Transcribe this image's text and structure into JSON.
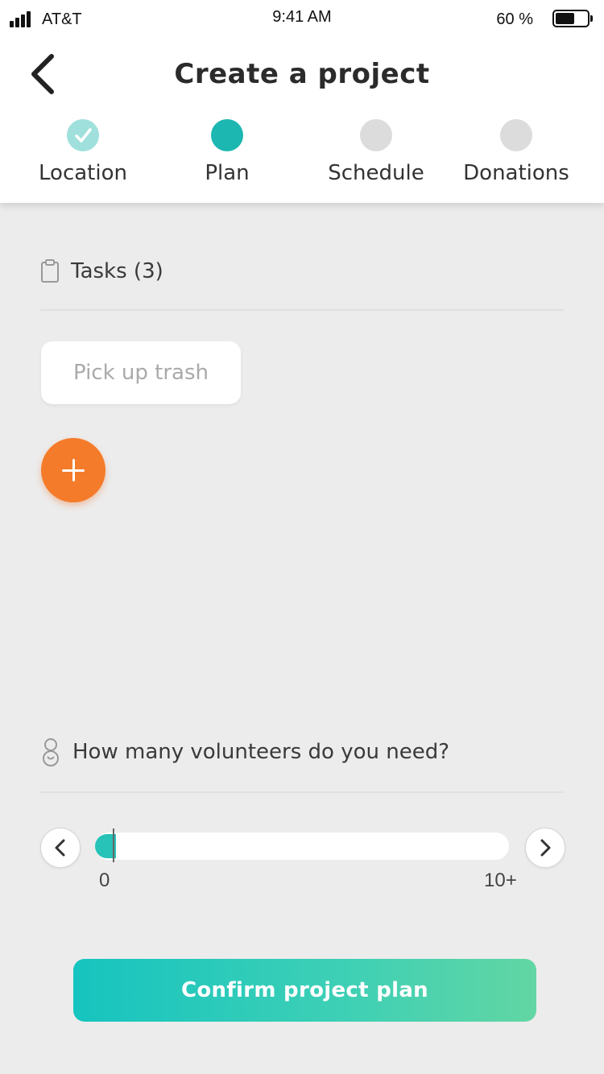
{
  "status_bar": {
    "carrier": "AT&T",
    "time": "9:41 AM",
    "battery_percent": "60 %",
    "battery_level": 0.6
  },
  "header": {
    "title": "Create a project",
    "steps": [
      {
        "label": "Location",
        "state": "done"
      },
      {
        "label": "Plan",
        "state": "active"
      },
      {
        "label": "Schedule",
        "state": "todo"
      },
      {
        "label": "Donations",
        "state": "todo"
      }
    ]
  },
  "tasks": {
    "heading": "Tasks (3)",
    "items": [
      "Pick up trash"
    ]
  },
  "volunteers": {
    "question": "How many volunteers do you need?",
    "min_label": "0",
    "max_label": "10+",
    "value": 0
  },
  "confirm_button": "Confirm project plan",
  "colors": {
    "accent": "#1bb7b0",
    "fab": "#f47b2a",
    "step_done": "#9fe0dc",
    "step_todo": "#dcdcdc"
  }
}
